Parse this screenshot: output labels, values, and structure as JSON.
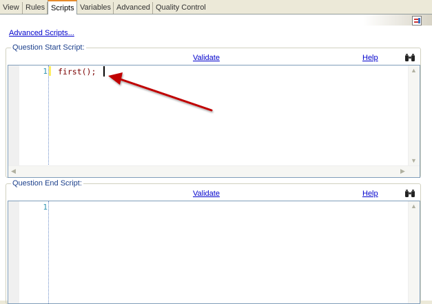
{
  "tabs": [
    {
      "label": "View"
    },
    {
      "label": "Rules"
    },
    {
      "label": "Scripts",
      "active": true
    },
    {
      "label": "Variables"
    },
    {
      "label": "Advanced"
    },
    {
      "label": "Quality Control"
    }
  ],
  "advanced_scripts_label": "Advanced Scripts...",
  "start_script": {
    "legend": "Question Start Script:",
    "validate_label": "Validate",
    "help_label": "Help",
    "find_icon": "binoculars-icon",
    "line_numbers": [
      "1"
    ],
    "code": "first();"
  },
  "end_script": {
    "legend": "Question End Script:",
    "validate_label": "Validate",
    "help_label": "Help",
    "find_icon": "binoculars-icon",
    "line_numbers": [
      "1"
    ],
    "code": ""
  },
  "annotation": {
    "color": "#c00000"
  },
  "colors": {
    "link": "#0000cc",
    "legend": "#1b3f8b",
    "code": "#7a0000",
    "line_number": "#2b91af",
    "active_tab_accent": "#e68b2c"
  }
}
